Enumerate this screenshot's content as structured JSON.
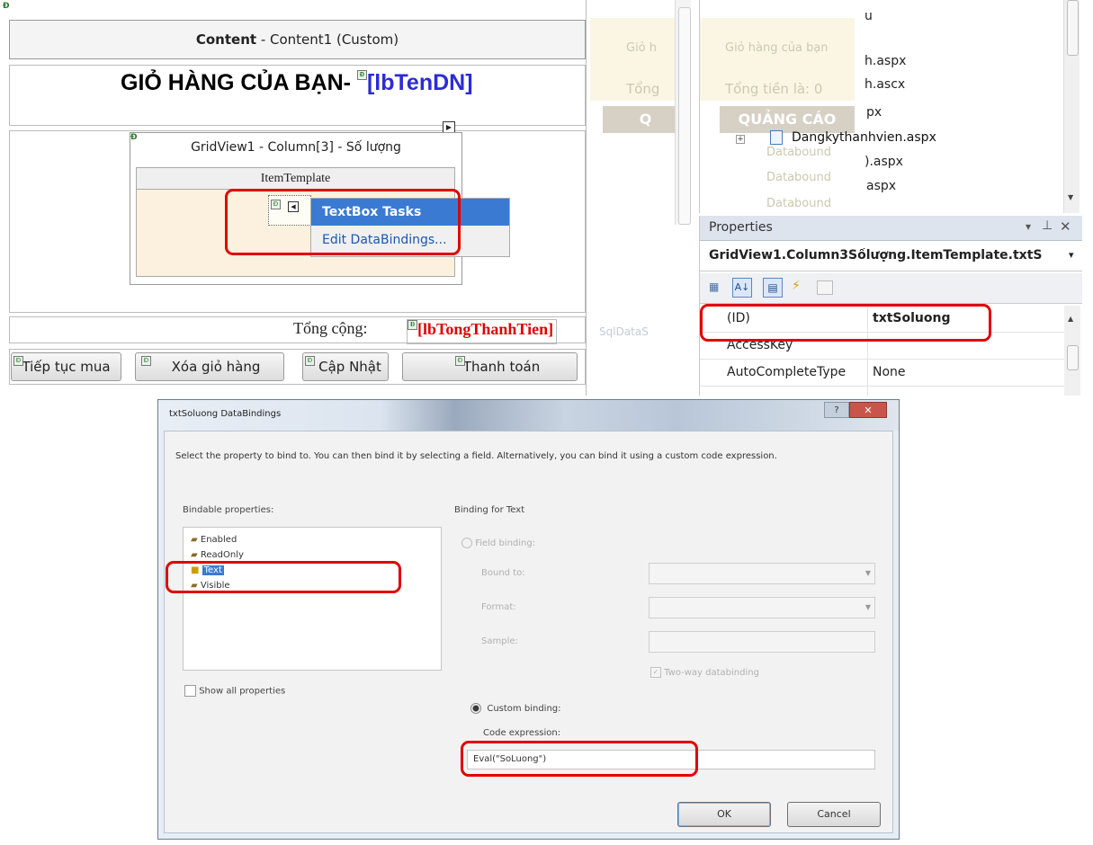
{
  "designer": {
    "content_label_bold": "Content",
    "content_label_rest": " - Content1 (Custom)",
    "heading": "GIỎ HÀNG CỦA BẠN-",
    "heading_label": "[lbTenDN]",
    "gridview_title": "GridView1 - Column[3] - Số lượng",
    "item_template": "ItemTemplate",
    "tasks_title": "TextBox Tasks",
    "tasks_edit": "Edit DataBindings...",
    "total_label": "Tổng cộng:",
    "total_value": "[lbTongThanhTien]",
    "buttons": [
      "Tiếp tục mua",
      "Xóa giỏ hàng",
      "Cập Nhật",
      "Thanh toán"
    ]
  },
  "background_panel": {
    "cart_label": "Giỏ hàng của bạn",
    "cart_label_short": "Giỏ h",
    "total_label": "Tổng tiền là: 0",
    "total_short": "Tổng",
    "ad_label": "QUẢNG CÁO",
    "ad_short": "Q",
    "databound": [
      "Databound",
      "Databound",
      "Databound"
    ],
    "sqldata": "SqlDataS"
  },
  "solution": {
    "items": [
      "u",
      "h.aspx",
      "h.ascx",
      "px",
      "Dangkythanhvien.aspx",
      ").aspx",
      "aspx",
      "px"
    ]
  },
  "properties": {
    "title": "Properties",
    "object": "GridView1.Column3Sốlượng.ItemTemplate.txtS",
    "rows": [
      {
        "name": "(ID)",
        "value": "txtSoluong"
      },
      {
        "name": "AccessKey",
        "value": ""
      },
      {
        "name": "AutoCompleteType",
        "value": "None"
      }
    ]
  },
  "dialog": {
    "title": "txtSoluong DataBindings",
    "description": "Select the property to bind to. You can then bind it by selecting a field. Alternatively, you can bind it using a custom code expression.",
    "bindable_label": "Bindable properties:",
    "properties": [
      "Enabled",
      "ReadOnly",
      "Text",
      "Visible"
    ],
    "binding_for": "Binding for Text",
    "field_binding": "Field binding:",
    "bound_to": "Bound to:",
    "format": "Format:",
    "sample": "Sample:",
    "two_way": "Two-way databinding",
    "show_all": "Show all properties",
    "custom_binding": "Custom binding:",
    "code_expression": "Code expression:",
    "code_value": "Eval(\"SoLuong\")",
    "ok": "OK",
    "cancel": "Cancel"
  }
}
